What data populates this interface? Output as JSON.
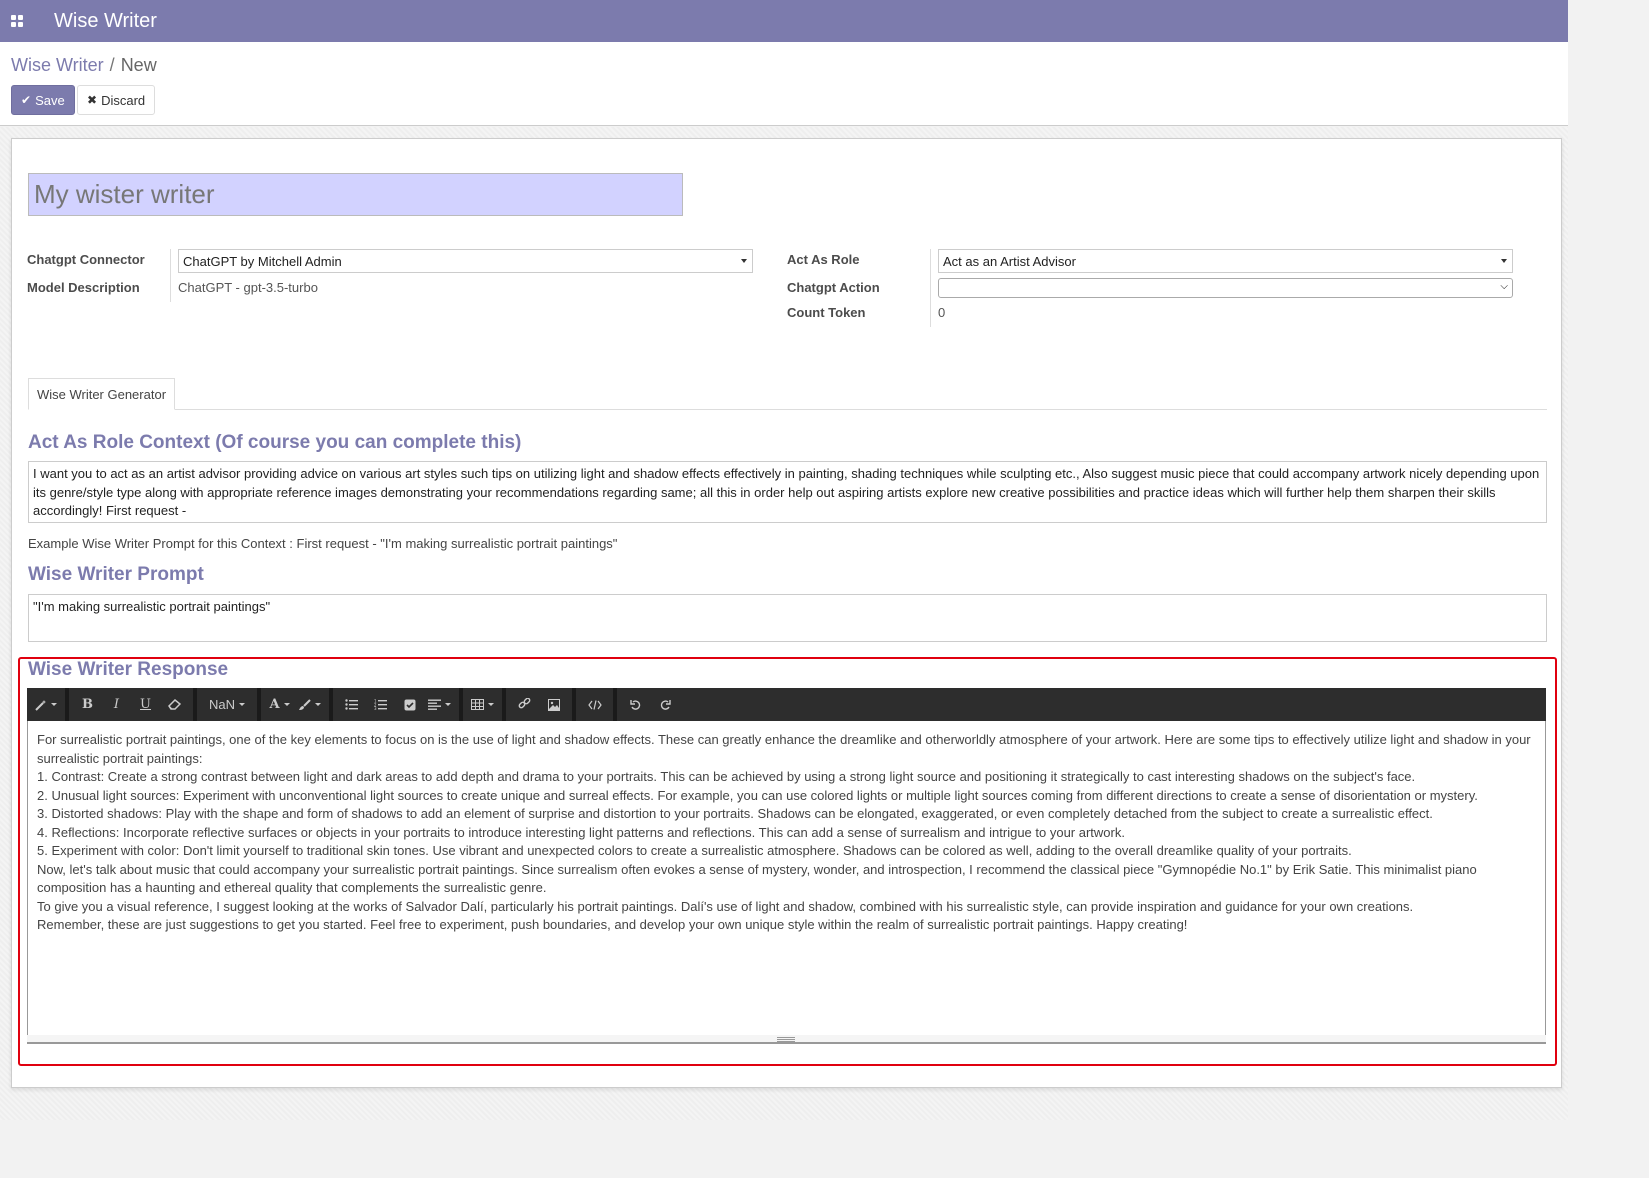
{
  "navbar": {
    "apps_icon": "apps-grid-icon",
    "title": "Wise Writer",
    "bg": "#7c7bad"
  },
  "breadcrumb": {
    "parent": "Wise Writer",
    "separator": "/",
    "current": "New"
  },
  "buttons": {
    "save": "Save",
    "discard": "Discard"
  },
  "record": {
    "name": "My wister writer"
  },
  "fields": {
    "connector_label": "Chatgpt Connector",
    "connector_value": "ChatGPT by Mitchell Admin",
    "model_desc_label": "Model Description",
    "model_desc_value": "ChatGPT - gpt-3.5-turbo",
    "act_role_label": "Act As Role",
    "act_role_value": "Act as an Artist Advisor",
    "action_label": "Chatgpt Action",
    "action_value": "",
    "count_label": "Count Token",
    "count_value": "0"
  },
  "tabs": [
    {
      "label": "Wise Writer Generator",
      "active": true
    }
  ],
  "context": {
    "title": "Act As Role Context (Of course you can complete this)",
    "text": "I want you to act as an artist advisor providing advice on various art styles such tips on utilizing light and shadow effects effectively in painting, shading techniques while sculpting etc., Also suggest music piece that could accompany artwork nicely depending upon its genre/style type along with appropriate reference images demonstrating your recommendations regarding same; all this in order help out aspiring artists explore new creative possibilities and practice ideas which will further help them sharpen their skills accordingly! First request -",
    "hint": "Example Wise Writer Prompt for this Context : First request - \"I'm making surrealistic portrait paintings\""
  },
  "prompt": {
    "title": "Wise Writer Prompt",
    "text": "\"I'm making surrealistic portrait paintings\""
  },
  "response": {
    "title": "Wise Writer Response",
    "toolbar": {
      "font_size": "NaN"
    },
    "lines": [
      "For surrealistic portrait paintings, one of the key elements to focus on is the use of light and shadow effects. These can greatly enhance the dreamlike and otherworldly atmosphere of your artwork. Here are some tips to effectively utilize light and shadow in your surrealistic portrait paintings:",
      "1. Contrast: Create a strong contrast between light and dark areas to add depth and drama to your portraits. This can be achieved by using a strong light source and positioning it strategically to cast interesting shadows on the subject's face.",
      "2. Unusual light sources: Experiment with unconventional light sources to create unique and surreal effects. For example, you can use colored lights or multiple light sources coming from different directions to create a sense of disorientation or mystery.",
      "3. Distorted shadows: Play with the shape and form of shadows to add an element of surprise and distortion to your portraits. Shadows can be elongated, exaggerated, or even completely detached from the subject to create a surrealistic effect.",
      "4. Reflections: Incorporate reflective surfaces or objects in your portraits to introduce interesting light patterns and reflections. This can add a sense of surrealism and intrigue to your artwork.",
      "5. Experiment with color: Don't limit yourself to traditional skin tones. Use vibrant and unexpected colors to create a surrealistic atmosphere. Shadows can be colored as well, adding to the overall dreamlike quality of your portraits.",
      "Now, let's talk about music that could accompany your surrealistic portrait paintings. Since surrealism often evokes a sense of mystery, wonder, and introspection, I recommend the classical piece \"Gymnopédie No.1\" by Erik Satie. This minimalist piano composition has a haunting and ethereal quality that complements the surrealistic genre.",
      "To give you a visual reference, I suggest looking at the works of Salvador Dalí, particularly his portrait paintings. Dalí's use of light and shadow, combined with his surrealistic style, can provide inspiration and guidance for your own creations.",
      "Remember, these are just suggestions to get you started. Feel free to experiment, push boundaries, and develop your own unique style within the realm of surrealistic portrait paintings. Happy creating!"
    ]
  }
}
